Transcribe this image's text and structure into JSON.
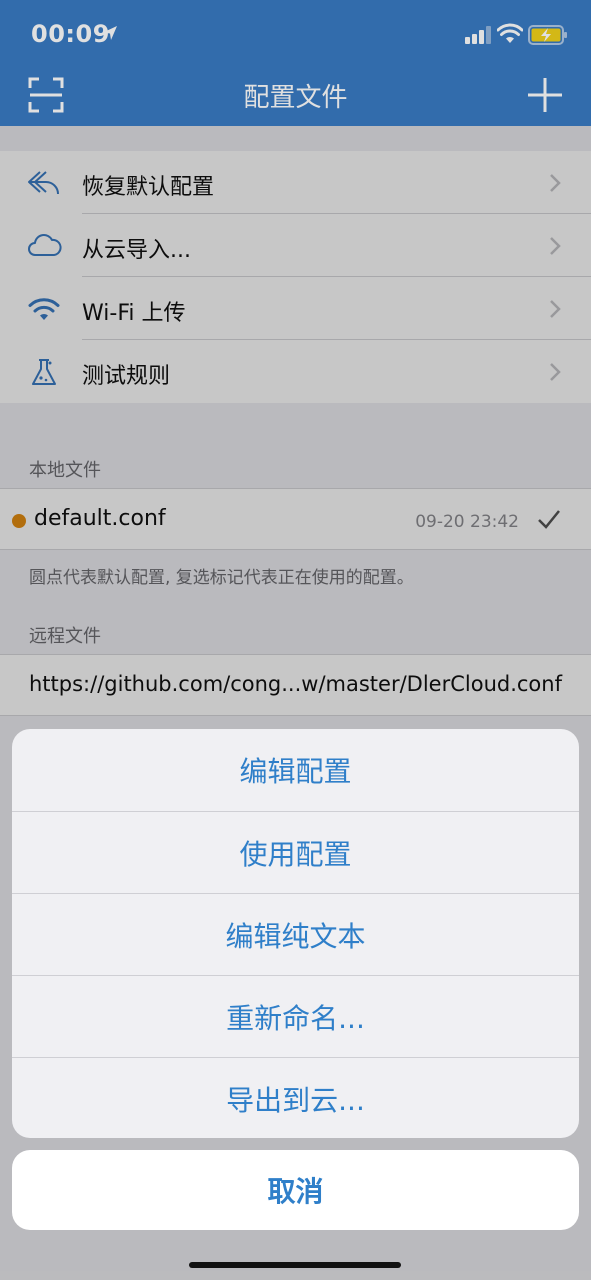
{
  "status_bar": {
    "time": "00:09"
  },
  "nav": {
    "title": "配置文件"
  },
  "menu": {
    "items": [
      {
        "label": "恢复默认配置",
        "icon": "undo-arrow-icon"
      },
      {
        "label": "从云导入...",
        "icon": "cloud-icon"
      },
      {
        "label": "Wi-Fi 上传",
        "icon": "wifi-icon"
      },
      {
        "label": "测试规则",
        "icon": "flask-icon"
      }
    ]
  },
  "local": {
    "header": "本地文件",
    "file": {
      "name": "default.conf",
      "date": "09-20 23:42"
    },
    "footnote": "圆点代表默认配置, 复选标记代表正在使用的配置。"
  },
  "remote": {
    "header": "远程文件",
    "url": "https://github.com/cong...w/master/DlerCloud.conf"
  },
  "action_sheet": {
    "actions": [
      "编辑配置",
      "使用配置",
      "编辑纯文本",
      "重新命名...",
      "导出到云..."
    ],
    "cancel": "取消"
  },
  "colors": {
    "header_bg": "#3a7bc4",
    "action_text": "#2f7fc9",
    "default_dot": "#e58e11"
  }
}
